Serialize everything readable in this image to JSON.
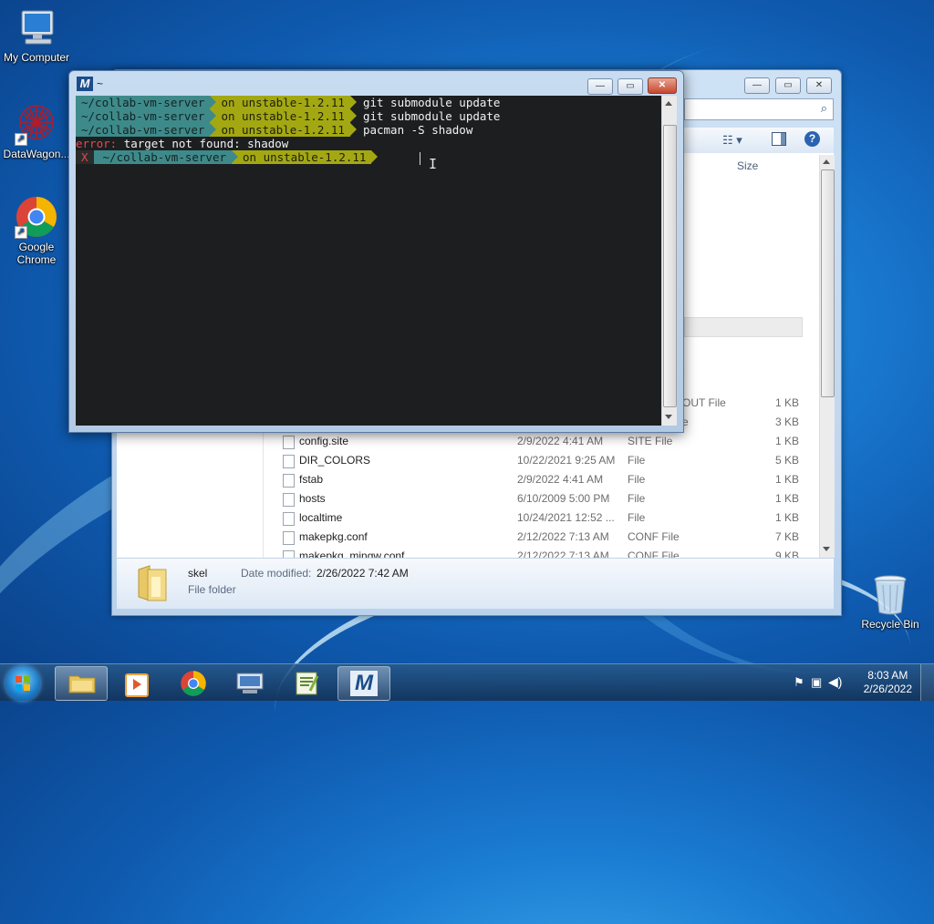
{
  "desktop": {
    "icons": [
      {
        "label": "My Computer"
      },
      {
        "label": "DataWagon..."
      },
      {
        "label": "Google Chrome"
      },
      {
        "label": "Recycle Bin"
      }
    ]
  },
  "terminal": {
    "title": "~",
    "prompt_dir": "~/collab-vm-server",
    "prompt_branch": "on unstable-1.2.11",
    "commands": [
      "git submodule update",
      "git submodule update",
      "pacman -S shadow"
    ],
    "error_keyword": "error:",
    "error_message": "target not found: shadow",
    "last_status": "X"
  },
  "explorer": {
    "column_size": "Size",
    "partial_rows": [
      {
        "type": "OUT File",
        "size": "1 KB"
      },
      {
        "type": "e",
        "size": "3 KB"
      }
    ],
    "files": [
      {
        "name": "config.site",
        "date": "2/9/2022 4:41 AM",
        "type": "SITE File",
        "size": "1 KB"
      },
      {
        "name": "DIR_COLORS",
        "date": "10/22/2021 9:25 AM",
        "type": "File",
        "size": "5 KB"
      },
      {
        "name": "fstab",
        "date": "2/9/2022 4:41 AM",
        "type": "File",
        "size": "1 KB"
      },
      {
        "name": "hosts",
        "date": "6/10/2009 5:00 PM",
        "type": "File",
        "size": "1 KB"
      },
      {
        "name": "localtime",
        "date": "10/24/2021 12:52 ...",
        "type": "File",
        "size": "1 KB"
      },
      {
        "name": "makepkg.conf",
        "date": "2/12/2022 7:13 AM",
        "type": "CONF File",
        "size": "7 KB"
      },
      {
        "name": "makepkg_mingw.conf",
        "date": "2/12/2022 7:13 AM",
        "type": "CONF File",
        "size": "9 KB"
      }
    ],
    "details": {
      "name": "skel",
      "date_label": "Date modified:",
      "date_value": "2/26/2022 7:42 AM",
      "type": "File folder"
    }
  },
  "taskbar": {
    "time": "8:03 AM",
    "date": "2/26/2022",
    "apps": [
      "file-explorer",
      "media-player",
      "chrome",
      "remote-desktop",
      "notepad",
      "msys2-terminal"
    ]
  },
  "colors": {
    "prompt_dir_bg": "#3e8a8a",
    "prompt_branch_bg": "#a3a812",
    "error": "#e54b4b",
    "terminal_bg": "#1c1e20"
  }
}
